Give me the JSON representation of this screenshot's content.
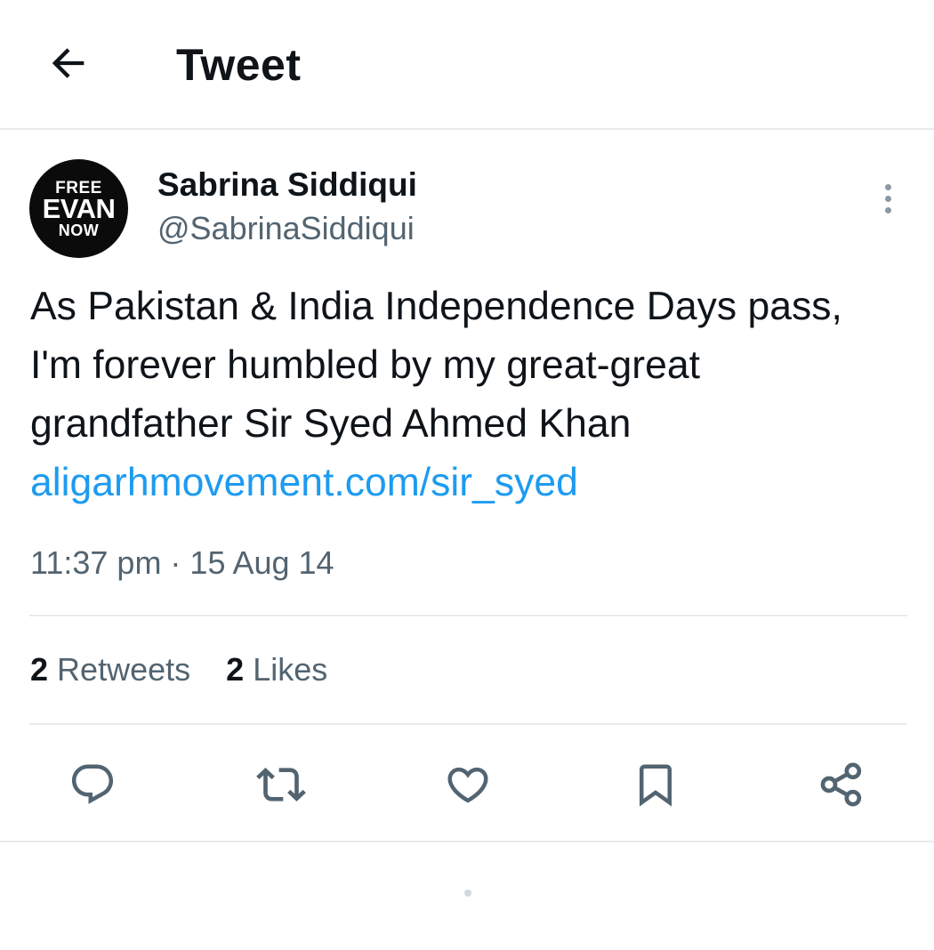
{
  "header": {
    "title": "Tweet",
    "back_icon": "arrow-left-icon"
  },
  "author": {
    "avatar": {
      "line1": "FREE",
      "line2": "EVAN",
      "line3": "NOW"
    },
    "name": "Sabrina Siddiqui",
    "handle": "@SabrinaSiddiqui"
  },
  "tweet": {
    "text": "As Pakistan & India Independence Days pass, I'm forever humbled by my great-great grandfather Sir Syed Ahmed Khan",
    "link": "aligarhmovement.com/sir_syed",
    "timestamp": "11:37 pm · 15 Aug 14"
  },
  "stats": {
    "retweets_count": "2",
    "retweets_label": "Retweets",
    "likes_count": "2",
    "likes_label": "Likes"
  },
  "actions": [
    {
      "name": "reply",
      "icon": "reply-icon"
    },
    {
      "name": "retweet",
      "icon": "retweet-icon"
    },
    {
      "name": "like",
      "icon": "heart-icon"
    },
    {
      "name": "bookmark",
      "icon": "bookmark-icon"
    },
    {
      "name": "share",
      "icon": "share-icon"
    }
  ],
  "colors": {
    "link": "#1d9bf0",
    "secondary_text": "#536471",
    "icon": "#536471",
    "divider": "#e7ebee"
  }
}
